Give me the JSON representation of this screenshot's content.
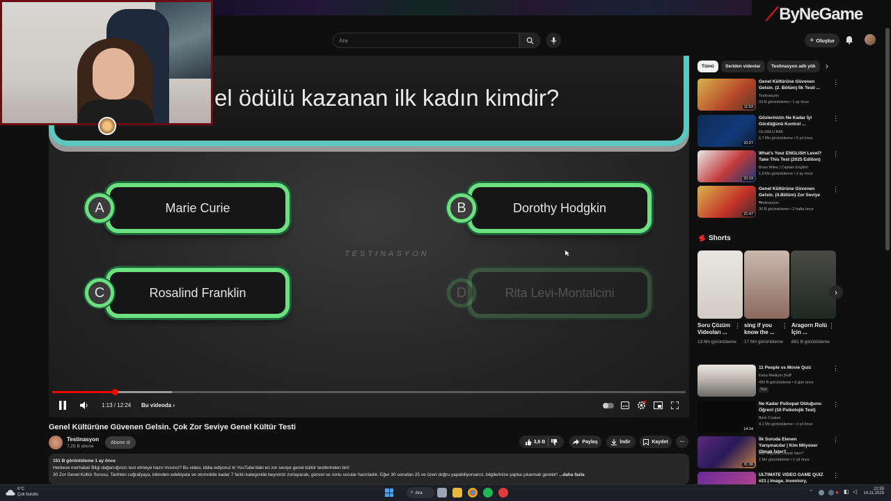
{
  "header": {
    "search_placeholder": "Ara",
    "create_label": "Oluştur",
    "logo_text": "ByNeGame"
  },
  "video": {
    "question": "el ödülü kazanan ilk kadın kimdir?",
    "answers": [
      {
        "letter": "A",
        "text": "Marie Curie"
      },
      {
        "letter": "B",
        "text": "Dorothy Hodgkin"
      },
      {
        "letter": "C",
        "text": "Rosalind Franklin"
      },
      {
        "letter": "D",
        "text": "Rita Levi-Montalcini"
      }
    ],
    "watermark": "TESTINASYON",
    "time": "1:13 / 12:24",
    "chapter": "Bu videoda",
    "progress": 0.098
  },
  "meta": {
    "title": "Genel Kültürüne Güvenen Gelsin. Çok Zor Seviye Genel Kültür Testi",
    "channel": "Testinasyon",
    "subs": "7,25 B abone",
    "subscribe": "Abone ol",
    "likes": "3,6 B",
    "share": "Paylaş",
    "download": "İndir",
    "save": "Kaydet",
    "desc_stats": "151 B görüntüleme  1 ay önce",
    "desc_line1": "Herkese merhaba! Bilgi dağarcığınızı test etmeye hazır mısınız? Bu video, iddia ediyoruz ki YouTube'daki en zor seviye genel kültür testlerinden biri!",
    "desc_line2": "30 Zor Genel Kültür Sorusu. Tarihten coğrafyaya, bilimden edebiyata ve otomobile kadar 7 farklı kategoride beyninizi zorlayacak, güncel ve zorlu sorular hazırladık. Eğer 30 sorudan 25 ve üzeri doğru yapabiliyorsanız, bilgilerinize şapka çıkarmak gerekir!",
    "more": "...daha fazla"
  },
  "sidebar": {
    "chips": [
      "Tümü",
      "Seriden videolar",
      "Testinasyon adlı yük"
    ],
    "recs": [
      {
        "title": "Genel Kültürüne Güvenen Gelsin. (2. Bölüm) İlk Testi ...",
        "channel": "Testinasyon",
        "meta": "33 B görüntüleme • 1 ay önce",
        "dur": "11:53"
      },
      {
        "title": "Gözlerinizin Ne Kadar İyi Gördüğünü Kontrol ...",
        "channel": "OLUMLU BAK",
        "meta": "6,7 Mn görüntüleme • 5 yıl önce",
        "dur": "20:27"
      },
      {
        "title": "What's Your ENGLISH Level? Take This Test (2025 Edition)",
        "channel": "Brian Wiles | Captain English",
        "meta": "1,9 Mn görüntüleme • 3 ay önce",
        "dur": "20:19"
      },
      {
        "title": "Genel Kültürüne Güvenen Gelsin. (4.Bölüm) Zor Seviye ...",
        "channel": "Testinasyon",
        "meta": "30 B görüntüleme • 2 hafta önce",
        "dur": "21:47"
      }
    ],
    "shorts_title": "Shorts",
    "shorts": [
      {
        "title": "Soru Çözüm Videoları ...",
        "views": "13 Mn görüntüleme"
      },
      {
        "title": "sing if you know the ...",
        "views": "17 Mn görüntüleme"
      },
      {
        "title": "Aragorn Rolü İçin ...",
        "views": "861 B görüntüleme"
      }
    ],
    "recs2": [
      {
        "title": "11 People vs Movie Quiz",
        "channel": "Extra Medium Stuff",
        "meta": "490 B görüntüleme • 6 gün önce",
        "badge": "Yeni",
        "dur": ""
      },
      {
        "title": "Ne Kadar Psikopat Olduğunu Öğren! (10 Psikolojik Test)",
        "channel": "Berk Coşkun",
        "meta": "4,1 Mn görüntüleme • 3 yıl önce",
        "dur": "14:34"
      },
      {
        "title": "İlk Soruda Elenen Yarışmacılar | Kim Milyoner Olmak İster?",
        "channel": "Kim Milyoner Olmak İster?",
        "meta": "1 Mn görüntüleme • 1 yıl önce",
        "dur": "31:36"
      },
      {
        "title": "ULTIMATE VIDEO GAME QUIZ #21 | Image, Inventory, Loadin...",
        "channel": "",
        "meta": "",
        "dur": ""
      }
    ]
  },
  "taskbar": {
    "weather_temp": "6°C",
    "weather_desc": "Çok bulutlu",
    "search": "Ara",
    "time": "22:55",
    "date": "14.11.2025"
  }
}
